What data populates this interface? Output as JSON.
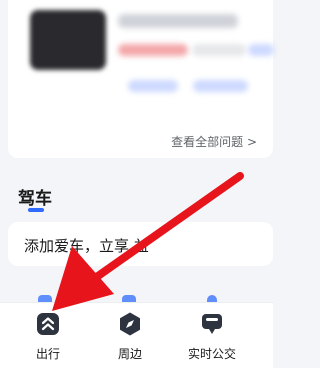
{
  "faq_card": {
    "view_all_label": "查看全部问题 >"
  },
  "driving_section": {
    "title": "驾车",
    "add_car_text": "添加爱车，立享 益"
  },
  "bottom_tabs": [
    {
      "label": "出行",
      "icon": "travel-icon"
    },
    {
      "label": "周边",
      "icon": "compass-icon"
    },
    {
      "label": "实时公交",
      "icon": "bus-icon"
    }
  ],
  "colors": {
    "accent": "#2f6bff",
    "annotation_arrow": "#e8141b",
    "icon_dark": "#2e3340"
  }
}
